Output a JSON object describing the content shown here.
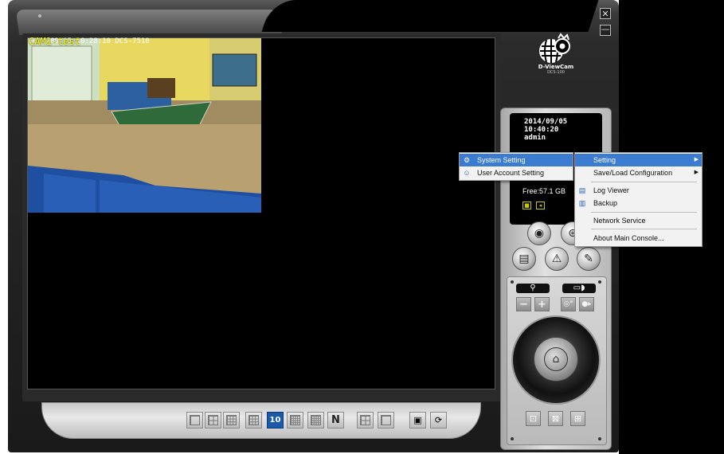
{
  "window": {
    "close_glyph": "✕",
    "minimize_glyph": "—"
  },
  "camera": {
    "name": "CAM1-test",
    "timestamp": "2014/09/05 10:28:10 DCS-7510"
  },
  "status": {
    "date": "2014/09/05",
    "time": "10:40:20",
    "user": "admin",
    "free_space": "Free:57.1 GB"
  },
  "layout_buttons": {
    "active_label": "10",
    "n_label": "N"
  },
  "context_menu": {
    "items": [
      {
        "label": "System Setting",
        "icon": "system-setting-icon"
      },
      {
        "label": "User Account Setting",
        "icon": "user-account-icon"
      }
    ]
  },
  "submenu": {
    "items": [
      {
        "label": "Setting"
      },
      {
        "label": "Save/Load Configuration"
      },
      {
        "label": "Log Viewer",
        "icon": "log-viewer-icon"
      },
      {
        "label": "Backup",
        "icon": "backup-icon"
      },
      {
        "label": "Network Service"
      },
      {
        "label": "About Main Console..."
      }
    ]
  },
  "logo": {
    "text": "D-ViewCam",
    "sub": "DCS-100"
  },
  "colors": {
    "menu_highlight": "#3b7bd0",
    "layout_active": "#1b5aa8",
    "camera_title": "#ffff00"
  }
}
